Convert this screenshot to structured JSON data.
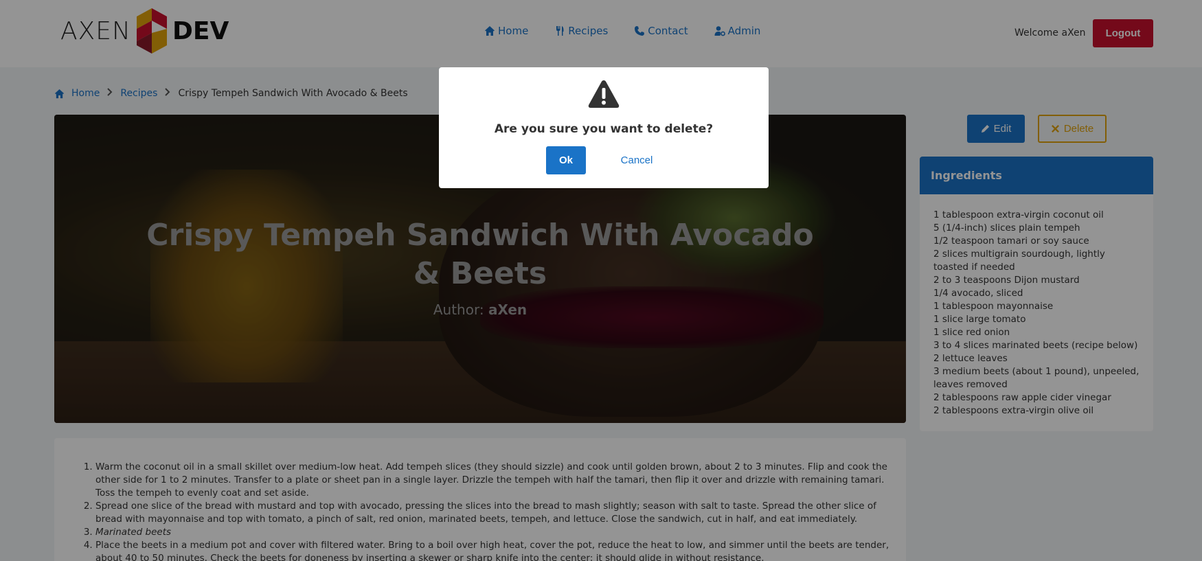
{
  "header": {
    "logo_left": "AXEN",
    "logo_right": "DEV",
    "nav": [
      {
        "label": "Home",
        "icon": "home-icon"
      },
      {
        "label": "Recipes",
        "icon": "utensils-icon"
      },
      {
        "label": "Contact",
        "icon": "phone-icon"
      },
      {
        "label": "Admin",
        "icon": "user-cog-icon"
      }
    ],
    "welcome": "Welcome aXen",
    "logout_label": "Logout"
  },
  "breadcrumb": {
    "home": "Home",
    "recipes": "Recipes",
    "current": "Crispy Tempeh Sandwich With Avocado & Beets"
  },
  "hero": {
    "title": "Crispy Tempeh Sandwich With Avocado & Beets",
    "author_label": "Author:",
    "author_name": "aXen"
  },
  "actions": {
    "edit_label": "Edit",
    "delete_label": "Delete"
  },
  "ingredients": {
    "title": "Ingredients",
    "items": [
      "1 tablespoon extra-virgin coconut oil",
      "5 (1/4-inch) slices plain tempeh",
      "1/2 teaspoon tamari or soy sauce",
      "2 slices multigrain sourdough, lightly toasted if needed",
      "2 to 3 teaspoons Dijon mustard",
      "1/4 avocado, sliced",
      "1 tablespoon mayonnaise",
      "1 slice large tomato",
      "1 slice red onion",
      "3 to 4 slices marinated beets (recipe below)",
      "2 lettuce leaves",
      "3 medium beets (about 1 pound), unpeeled, leaves removed",
      "2 tablespoons raw apple cider vinegar",
      "2 tablespoons extra-virgin olive oil"
    ]
  },
  "method": {
    "steps": [
      "Warm the coconut oil in a small skillet over medium-low heat. Add tempeh slices (they should sizzle) and cook until golden brown, about 2 to 3 minutes. Flip and cook the other side for 1 to 2 minutes. Transfer to a plate or sheet pan in a single layer. Drizzle the tempeh with half the tamari, then flip it over and drizzle with remaining tamari. Toss the tempeh to evenly coat and set aside.",
      "Spread one slice of the bread with mustard and top with avocado, pressing the slices into the bread to mash slightly; season with salt to taste. Spread the other slice of bread with mayonnaise and top with tomato, a pinch of salt, red onion, marinated beets, tempeh, and lettuce. Close the sandwich, cut in half, and eat immediately.",
      "Marinated beets",
      "Place the beets in a medium pot and cover with filtered water. Bring to a boil over high heat, cover the pot, reduce the heat to low, and simmer until the beets are tender, about 40 to 50 minutes. Check the beets for doneness by inserting a skewer or sharp knife into the center; it should glide in without resistance."
    ]
  },
  "modal": {
    "message": "Are you sure you want to delete?",
    "ok_label": "Ok",
    "cancel_label": "Cancel"
  },
  "colors": {
    "primary": "#1a73c7",
    "logout": "#c8102e",
    "delete_outline": "#e0a20c"
  }
}
